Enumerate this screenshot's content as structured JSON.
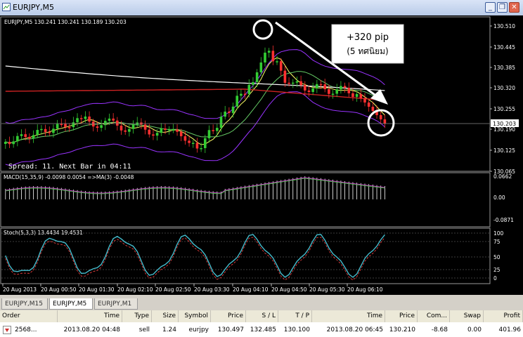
{
  "window": {
    "title": "EURJPY,M5"
  },
  "main_chart": {
    "header": "EURJPY,M5  130.241 130.241 130.189 130.203",
    "current_price": "130.203",
    "price_labels": [
      "130.510",
      "130.445",
      "130.385",
      "130.320",
      "130.255",
      "130.190",
      "130.125",
      "130.065"
    ],
    "status_text": "Spread: 11. Next Bar in 04:11",
    "callout_line1": "+320 pip",
    "callout_line2": "(5 ทศนิยม)"
  },
  "macd_panel": {
    "header": "MACD(15,35,9) -0.0098 0.0054  =>MA(3) -0.0048",
    "labels": [
      "0.0662",
      "0.00",
      "-0.0871"
    ]
  },
  "stoch_panel": {
    "header": "Stoch(5,3,3) 13.4434 19.4531",
    "labels": [
      "100",
      "75",
      "50",
      "25",
      "0"
    ]
  },
  "time_axis": [
    "20 Aug 2013",
    "20 Aug 00:50",
    "20 Aug 01:30",
    "20 Aug 02:10",
    "20 Aug 02:50",
    "20 Aug 03:30",
    "20 Aug 04:10",
    "20 Aug 04:50",
    "20 Aug 05:30",
    "20 Aug 06:10"
  ],
  "tabs": [
    {
      "label": "EURJPY,M15"
    },
    {
      "label": "EURJPY,M5"
    },
    {
      "label": "EURJPY,M1"
    }
  ],
  "terminal": {
    "headers": [
      "Order",
      "Time",
      "Type",
      "Size",
      "Symbol",
      "Price",
      "S / L",
      "T / P",
      "Time",
      "Price",
      "Com...",
      "Swap",
      "Profit"
    ],
    "row": [
      "2568...",
      "2013.08.20 04:48",
      "sell",
      "1.24",
      "eurjpy",
      "130.497",
      "132.485",
      "130.100",
      "2013.08.20 06:45",
      "130.210",
      "-8.68",
      "0.00",
      "401.96"
    ]
  },
  "colors": {
    "bull": "#33cc33",
    "bear": "#ff3030",
    "bands": "#9933ff",
    "ma_fast": "#ffff66",
    "ma_mid": "#ffffff",
    "ma_slow": "#cc2222",
    "stoch_main": "#44bbcc",
    "stoch_signal": "#ff4444",
    "macd_signal": "#cc44cc"
  }
}
